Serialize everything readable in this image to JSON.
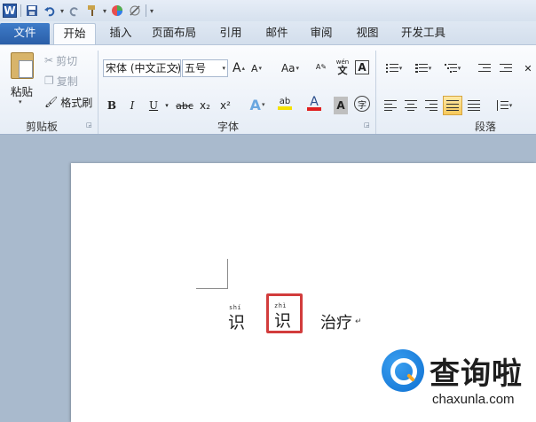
{
  "quick_access": {
    "word_logo": "W",
    "customize_arrow": "▾"
  },
  "tabs": [
    {
      "label": "文件"
    },
    {
      "label": "开始"
    },
    {
      "label": "插入"
    },
    {
      "label": "页面布局"
    },
    {
      "label": "引用"
    },
    {
      "label": "邮件"
    },
    {
      "label": "审阅"
    },
    {
      "label": "视图"
    },
    {
      "label": "开发工具"
    }
  ],
  "clipboard": {
    "paste_label": "粘贴",
    "cut_label": "剪切",
    "copy_label": "复制",
    "format_painter_label": "格式刷",
    "group_label": "剪贴板"
  },
  "font": {
    "font_name": "宋体 (中文正文)",
    "font_size": "五号",
    "grow_label": "A",
    "shrink_label": "A",
    "change_case_label": "Aa",
    "pinyin_guide_label": "wén",
    "border_char_label": "A",
    "bold_label": "B",
    "italic_label": "I",
    "underline_label": "U",
    "strike_label": "abc",
    "subscript_label": "x₂",
    "superscript_label": "x²",
    "text_effect_label": "A",
    "highlight_label": "ab",
    "font_color_label": "A",
    "char_shading_label": "A",
    "enclose_label": "字",
    "group_label": "字体"
  },
  "paragraph": {
    "group_label": "段落"
  },
  "document": {
    "chars": [
      {
        "pinyin": "shí",
        "hanzi": "识"
      },
      {
        "pinyin": "zhì",
        "hanzi": "识"
      }
    ],
    "rest_text": "治疗",
    "para_mark": "↵"
  },
  "watermark": {
    "title": "查询啦",
    "subtitle": "chaxunla.com"
  },
  "colors": {
    "file_tab": "#2a5ea8",
    "highlight_box": "#d23c3c",
    "font_color_bar": "#e02020",
    "highlight_bar": "#f5e100"
  }
}
